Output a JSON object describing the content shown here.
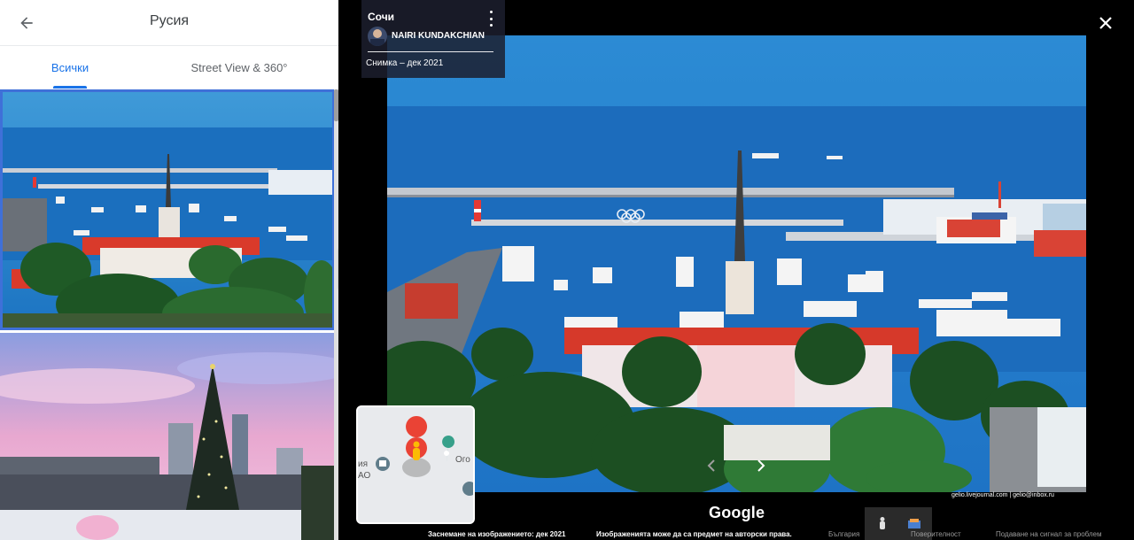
{
  "panel": {
    "title": "Русия",
    "tabs": [
      {
        "label": "Всички",
        "active": true
      },
      {
        "label": "Street View & 360°",
        "active": false
      }
    ],
    "thumb1_watermark": "gelio.livejournal.com | gelio@"
  },
  "viewer": {
    "place": "Сочи",
    "author": "NAIRI KUNDAKCHIAN",
    "date": "Снимка – дек 2021",
    "minimap_labels": [
      "ия",
      "АО",
      "Ого"
    ],
    "credit": "gelio.livejournal.com  |  gelio@inbox.ru",
    "brand": "Google",
    "footer": {
      "capture": "Заснемане на изображението: дек 2021",
      "copyright": "Изображенията може да са предмет на авторски права.",
      "country": "България",
      "privacy": "Поверителност",
      "report": "Подаване на сигнал за проблем"
    }
  },
  "colors": {
    "accent": "#1a73e8",
    "selected_border": "#3f70d8",
    "pin": "#ea4335",
    "pegman": "#fbbc04",
    "map_pin": "#37a08a"
  }
}
